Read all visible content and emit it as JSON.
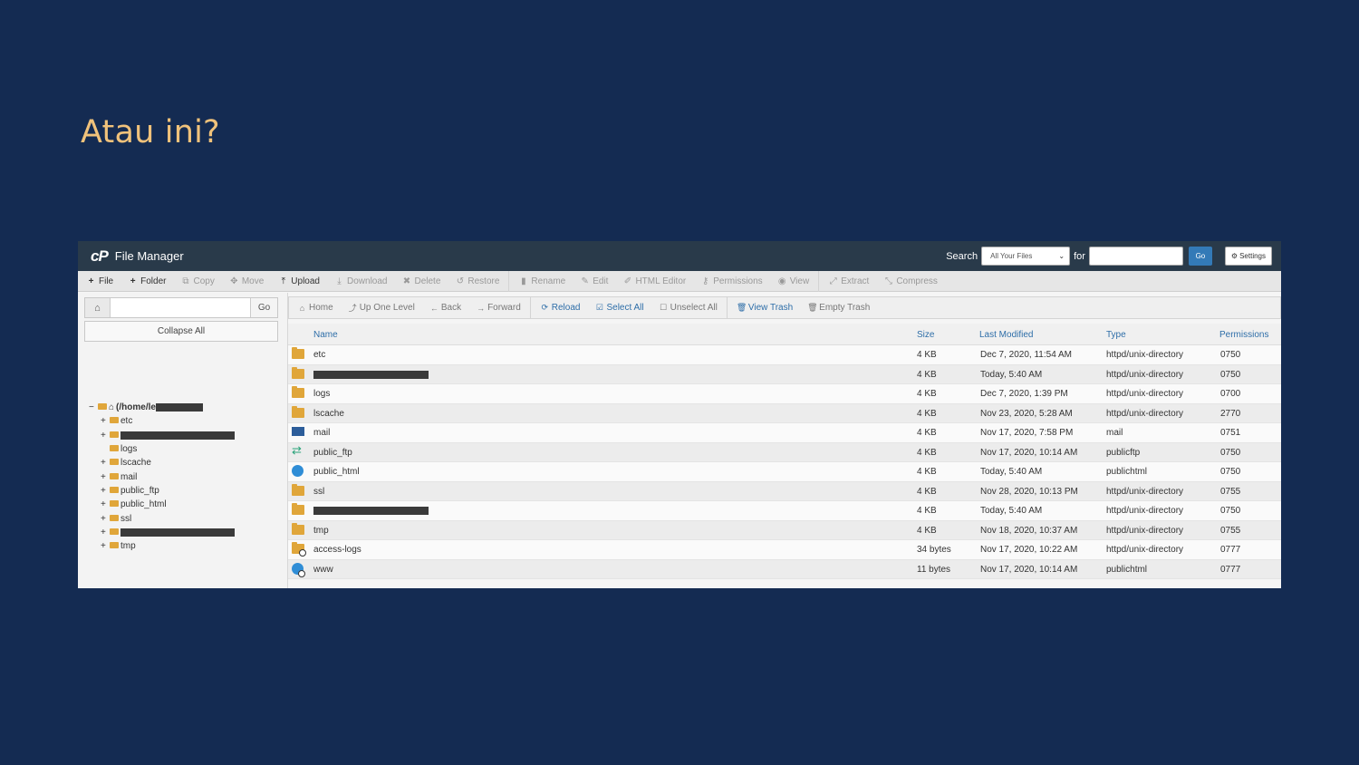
{
  "slide": {
    "title": "Atau ini?"
  },
  "app": {
    "logo": "cP",
    "title": "File Manager"
  },
  "search": {
    "label": "Search",
    "scope": "All Your Files",
    "for_label": "for",
    "go": "Go",
    "settings": "Settings"
  },
  "toolbar": [
    {
      "icon": "plus-icon",
      "glyph": "+",
      "label": "File",
      "enabled": true
    },
    {
      "icon": "plus-icon",
      "glyph": "+",
      "label": "Folder",
      "enabled": true
    },
    {
      "icon": "copy-icon",
      "glyph": "⧉",
      "label": "Copy",
      "enabled": false
    },
    {
      "icon": "move-icon",
      "glyph": "✥",
      "label": "Move",
      "enabled": false
    },
    {
      "icon": "upload-icon",
      "glyph": "⤒",
      "label": "Upload",
      "enabled": true
    },
    {
      "icon": "download-icon",
      "glyph": "⤓",
      "label": "Download",
      "enabled": false
    },
    {
      "icon": "delete-icon",
      "glyph": "✖",
      "label": "Delete",
      "enabled": false
    },
    {
      "icon": "restore-icon",
      "glyph": "↺",
      "label": "Restore",
      "enabled": false
    },
    {
      "icon": "rename-icon",
      "glyph": "▮",
      "label": "Rename",
      "enabled": false
    },
    {
      "icon": "edit-icon",
      "glyph": "✎",
      "label": "Edit",
      "enabled": false
    },
    {
      "icon": "html-editor-icon",
      "glyph": "✐",
      "label": "HTML Editor",
      "enabled": false
    },
    {
      "icon": "key-icon",
      "glyph": "⚷",
      "label": "Permissions",
      "enabled": false
    },
    {
      "icon": "eye-icon",
      "glyph": "◉",
      "label": "View",
      "enabled": false
    },
    {
      "icon": "extract-icon",
      "glyph": "⤢",
      "label": "Extract",
      "enabled": false
    },
    {
      "icon": "compress-icon",
      "glyph": "⤡",
      "label": "Compress",
      "enabled": false
    }
  ],
  "left": {
    "go": "Go",
    "collapse": "Collapse All"
  },
  "tree": [
    {
      "toggle": "−",
      "label": "(/home/le",
      "redacted": true,
      "root": true
    },
    {
      "toggle": "+",
      "label": "etc"
    },
    {
      "toggle": "+",
      "label": "",
      "redacted": true
    },
    {
      "toggle": "",
      "label": "logs"
    },
    {
      "toggle": "+",
      "label": "lscache"
    },
    {
      "toggle": "+",
      "label": "mail"
    },
    {
      "toggle": "+",
      "label": "public_ftp"
    },
    {
      "toggle": "+",
      "label": "public_html"
    },
    {
      "toggle": "+",
      "label": "ssl"
    },
    {
      "toggle": "+",
      "label": "",
      "redacted": true
    },
    {
      "toggle": "+",
      "label": "tmp"
    }
  ],
  "nav": [
    {
      "icon": "home-icon",
      "glyph": "⌂",
      "label": "Home",
      "blue": false
    },
    {
      "icon": "up-level-icon",
      "glyph": "⤴",
      "label": "Up One Level",
      "blue": false
    },
    {
      "icon": "back-icon",
      "glyph": "←",
      "label": "Back",
      "blue": false
    },
    {
      "icon": "forward-icon",
      "glyph": "→",
      "label": "Forward",
      "blue": false
    },
    {
      "icon": "reload-icon",
      "glyph": "⟳",
      "label": "Reload",
      "blue": true
    },
    {
      "icon": "checkbox-checked-icon",
      "glyph": "☑",
      "label": "Select All",
      "blue": true
    },
    {
      "icon": "checkbox-empty-icon",
      "glyph": "☐",
      "label": "Unselect All",
      "blue": false
    },
    {
      "icon": "trash-icon",
      "glyph": "🗑",
      "label": "View Trash",
      "blue": true
    },
    {
      "icon": "trash-icon",
      "glyph": "🗑",
      "label": "Empty Trash",
      "blue": false
    }
  ],
  "columns": {
    "name": "Name",
    "size": "Size",
    "modified": "Last Modified",
    "type": "Type",
    "perms": "Permissions"
  },
  "files": [
    {
      "icon": "folder",
      "name": "etc",
      "size": "4 KB",
      "modified": "Dec 7, 2020, 11:54 AM",
      "type": "httpd/unix-directory",
      "perms": "0750"
    },
    {
      "icon": "folder",
      "name": "",
      "redacted": true,
      "size": "4 KB",
      "modified": "Today, 5:40 AM",
      "type": "httpd/unix-directory",
      "perms": "0750"
    },
    {
      "icon": "folder",
      "name": "logs",
      "size": "4 KB",
      "modified": "Dec 7, 2020, 1:39 PM",
      "type": "httpd/unix-directory",
      "perms": "0700"
    },
    {
      "icon": "folder",
      "name": "lscache",
      "size": "4 KB",
      "modified": "Nov 23, 2020, 5:28 AM",
      "type": "httpd/unix-directory",
      "perms": "2770"
    },
    {
      "icon": "mail",
      "name": "mail",
      "size": "4 KB",
      "modified": "Nov 17, 2020, 7:58 PM",
      "type": "mail",
      "perms": "0751"
    },
    {
      "icon": "ftp",
      "name": "public_ftp",
      "size": "4 KB",
      "modified": "Nov 17, 2020, 10:14 AM",
      "type": "publicftp",
      "perms": "0750"
    },
    {
      "icon": "globe",
      "name": "public_html",
      "size": "4 KB",
      "modified": "Today, 5:40 AM",
      "type": "publichtml",
      "perms": "0750"
    },
    {
      "icon": "folder",
      "name": "ssl",
      "size": "4 KB",
      "modified": "Nov 28, 2020, 10:13 PM",
      "type": "httpd/unix-directory",
      "perms": "0755"
    },
    {
      "icon": "folder",
      "name": "",
      "redacted": true,
      "size": "4 KB",
      "modified": "Today, 5:40 AM",
      "type": "httpd/unix-directory",
      "perms": "0750"
    },
    {
      "icon": "folder",
      "name": "tmp",
      "size": "4 KB",
      "modified": "Nov 18, 2020, 10:37 AM",
      "type": "httpd/unix-directory",
      "perms": "0755"
    },
    {
      "icon": "folder-link",
      "name": "access-logs",
      "size": "34 bytes",
      "modified": "Nov 17, 2020, 10:22 AM",
      "type": "httpd/unix-directory",
      "perms": "0777"
    },
    {
      "icon": "globe-link",
      "name": "www",
      "size": "11 bytes",
      "modified": "Nov 17, 2020, 10:14 AM",
      "type": "publichtml",
      "perms": "0777"
    }
  ]
}
